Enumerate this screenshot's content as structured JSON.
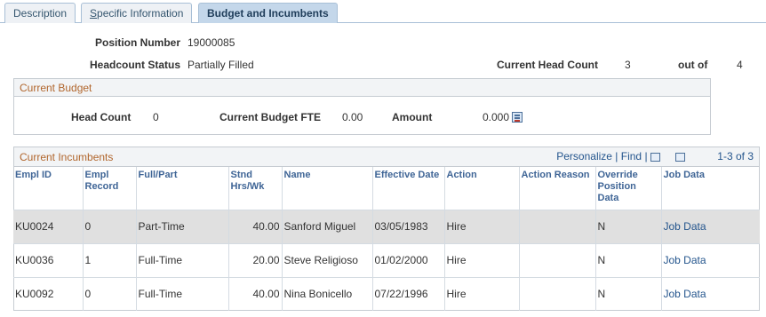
{
  "tabs": [
    {
      "label": "Description"
    },
    {
      "label_prefix": "S",
      "label_rest": "pecific Information"
    },
    {
      "label": "Budget and Incumbents"
    }
  ],
  "header": {
    "position_number_label": "Position Number",
    "position_number": "19000085",
    "headcount_status_label": "Headcount Status",
    "headcount_status": "Partially Filled",
    "current_head_count_label": "Current Head Count",
    "current_head_count": "3",
    "out_of_label": "out of",
    "out_of": "4"
  },
  "budget": {
    "title": "Current Budget",
    "head_count_label": "Head Count",
    "head_count": "0",
    "fte_label": "Current Budget FTE",
    "fte": "0.00",
    "amount_label": "Amount",
    "amount": "0.000"
  },
  "incumbents": {
    "title": "Current Incumbents",
    "personalize": "Personalize",
    "find": "Find",
    "separator": "|",
    "range": "1-3 of 3",
    "columns": {
      "emplid": "Empl ID",
      "empl_record": "Empl Record",
      "full_part": "Full/Part",
      "std_hrs": "Stnd Hrs/Wk",
      "name": "Name",
      "effective_date": "Effective Date",
      "action": "Action",
      "action_reason": "Action Reason",
      "override": "Override Position Data",
      "job_data": "Job Data"
    },
    "rows": [
      {
        "emplid": "KU0024",
        "empl_record": "0",
        "full_part": "Part-Time",
        "std_hrs": "40.00",
        "name": "Sanford Miguel",
        "effective_date": "03/05/1983",
        "action": "Hire",
        "action_reason": "",
        "override": "N",
        "job_data": "Job Data"
      },
      {
        "emplid": "KU0036",
        "empl_record": "1",
        "full_part": "Full-Time",
        "std_hrs": "20.00",
        "name": "Steve Religioso",
        "effective_date": "01/02/2000",
        "action": "Hire",
        "action_reason": "",
        "override": "N",
        "job_data": "Job Data"
      },
      {
        "emplid": "KU0092",
        "empl_record": "0",
        "full_part": "Full-Time",
        "std_hrs": "40.00",
        "name": "Nina Bonicello",
        "effective_date": "07/22/1996",
        "action": "Hire",
        "action_reason": "",
        "override": "N",
        "job_data": "Job Data"
      }
    ]
  }
}
